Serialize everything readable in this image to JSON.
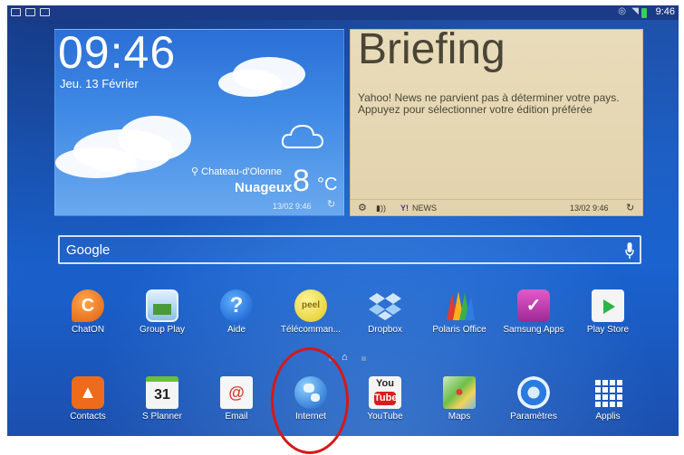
{
  "status_bar": {
    "time": "9:46"
  },
  "clock_widget": {
    "time": "09:46",
    "date": "Jeu. 13 Février",
    "location": "Chateau-d'Olonne",
    "condition": "Nuageux",
    "temperature": "8",
    "unit": "°C",
    "updated": "13/02 9:46"
  },
  "briefing": {
    "title": "Briefing",
    "message": "Yahoo! News ne parvient pas à déterminer votre pays. Appuyez pour sélectionner votre édition préférée",
    "news_label": "NEWS",
    "updated": "13/02 9:46"
  },
  "search": {
    "label": "Google"
  },
  "apps_row1": [
    {
      "label": "ChatON",
      "color": "#f07a1a"
    },
    {
      "label": "Group Play",
      "color": "#3a8a3a"
    },
    {
      "label": "Aide",
      "color": "#1f73e0"
    },
    {
      "label": "Télécomman...",
      "color": "#f2e23a"
    },
    {
      "label": "Dropbox",
      "color": "#7fb8ec"
    },
    {
      "label": "Polaris Office",
      "color": "#f0b020"
    },
    {
      "label": "Samsung Apps",
      "color": "#c63fb2"
    },
    {
      "label": "Play Store",
      "color": "#f1f1f1"
    }
  ],
  "dock": [
    {
      "label": "Contacts",
      "color": "#f07220"
    },
    {
      "label": "S Planner",
      "color": "#f2f2f2",
      "day": "31"
    },
    {
      "label": "Email",
      "color": "#f4f4f4"
    },
    {
      "label": "Internet",
      "color": "#2b8ee6"
    },
    {
      "label": "YouTube",
      "color": "#d81d1d",
      "logo_top": "You",
      "logo_bottom": "Tube"
    },
    {
      "label": "Maps",
      "color": "#6cbf4a"
    },
    {
      "label": "Paramètres",
      "color": "#2c74d3"
    },
    {
      "label": "Applis",
      "color": "#1d5fc4"
    }
  ]
}
